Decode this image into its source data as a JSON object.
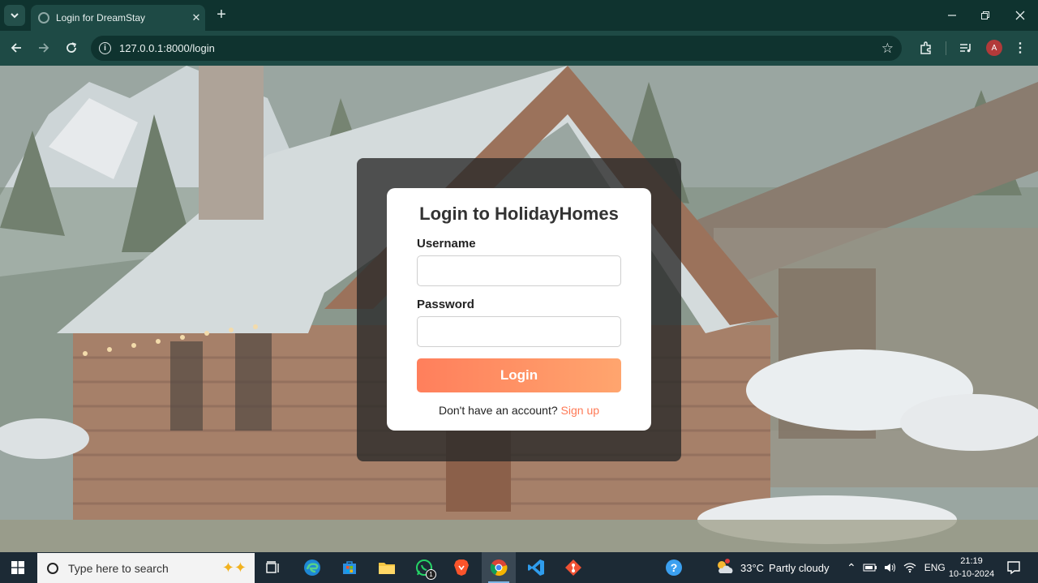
{
  "browser": {
    "tab_title": "Login for DreamStay",
    "url": "127.0.0.1:8000/login",
    "profile_initial": "A"
  },
  "login": {
    "heading": "Login to HolidayHomes",
    "username_label": "Username",
    "username_value": "",
    "password_label": "Password",
    "password_value": "",
    "button_label": "Login",
    "signup_prompt": "Don't have an account?",
    "signup_link": "Sign up"
  },
  "taskbar": {
    "search_placeholder": "Type here to search",
    "whatsapp_badge": "1",
    "weather_temp": "33°C",
    "weather_desc": "Partly cloudy",
    "language": "ENG",
    "time": "21:19",
    "date": "10-10-2024"
  },
  "colors": {
    "accent": "#ff8a5f",
    "link": "#ff7a56",
    "browser_frame": "#1e4a45"
  }
}
